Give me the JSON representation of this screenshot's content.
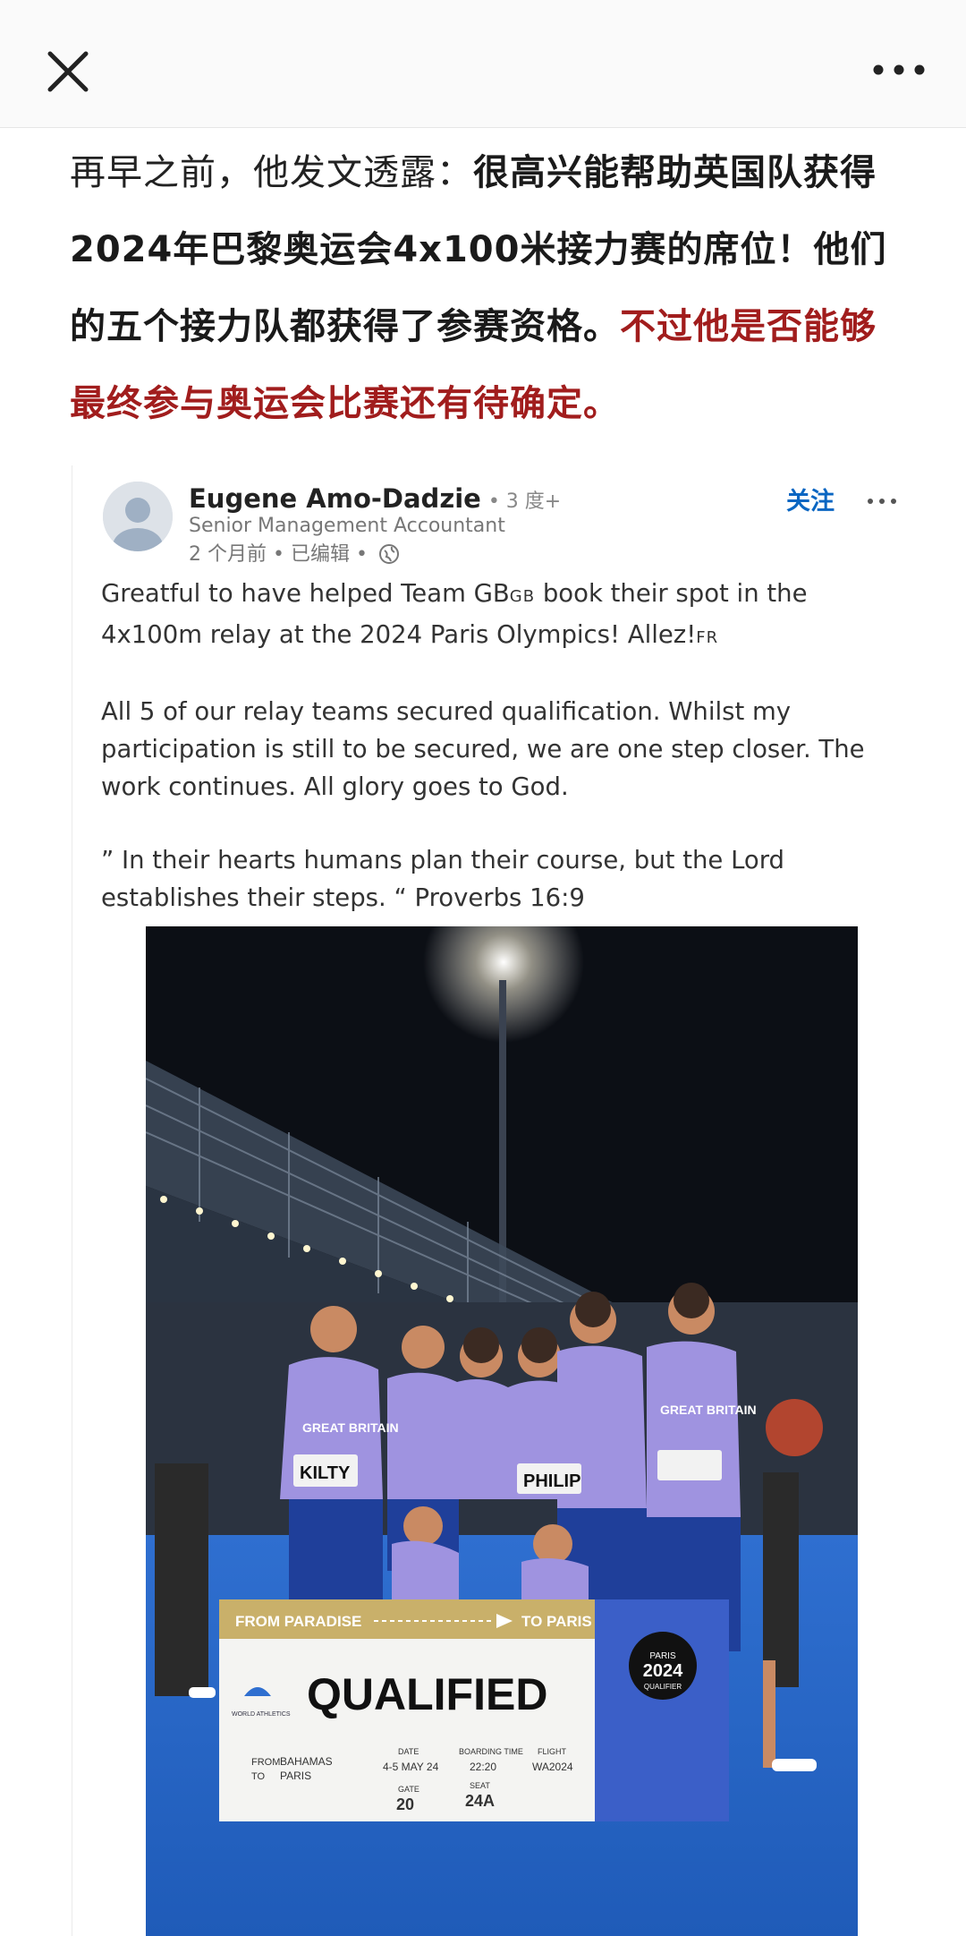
{
  "header": {
    "close_icon": "close-icon",
    "more_icon": "more-horizontal-icon"
  },
  "article": {
    "p1_plain": "再早之前，他发文透露：",
    "p1_bold": "很高兴能帮助英国队获得2024年巴黎奥运会4x100米接力赛的席位！他们的五个接力队都获得了参赛资格。",
    "p1_red": "不过他是否能够最终参与奥运会比赛还有待确定。"
  },
  "post": {
    "author": "Eugene Amo-Dadzie",
    "degree": "• 3 度+",
    "headline": "Senior Management Accountant",
    "time": "2 个月前 • 已编辑 •",
    "follow_label": "关注",
    "p1_a": "Greatful to have helped Team GB",
    "p1_gb": "GB",
    "p1_b": " book their spot in the 4x100m relay at the 2024 Paris Olympics! Allez!",
    "p1_fr": "FR",
    "p2": "All 5 of our relay teams secured qualification. Whilst my participation is still to be secured, we are one step closer. The work continues. All glory goes to God.",
    "p3": "”  In their hearts humans plan their course, but the Lord establishes their steps. “ Proverbs 16:9"
  },
  "photo": {
    "banner_from": "FROM PARADISE",
    "banner_to": "TO PARIS",
    "ticket_title": "QUALIFIED",
    "org_label": "WORLD ATHLETICS",
    "from_label": "FROM",
    "from_value": "BAHAMAS",
    "to_label": "TO",
    "to_value": "PARIS",
    "date_label": "DATE",
    "date_value": "4-5 MAY 24",
    "boarding_label": "BOARDING TIME",
    "boarding_value": "22:20",
    "flight_label": "FLIGHT",
    "flight_value": "WA2024",
    "gate_label": "GATE",
    "gate_value": "20",
    "seat_label": "SEAT",
    "seat_value": "24A",
    "paris_line1": "PARIS",
    "paris_line2": "2024",
    "paris_line3": "QUALIFIER",
    "bib_1": "KILTY",
    "bib_2": "PHILIP",
    "shirt_text": "GREAT BRITAIN"
  }
}
